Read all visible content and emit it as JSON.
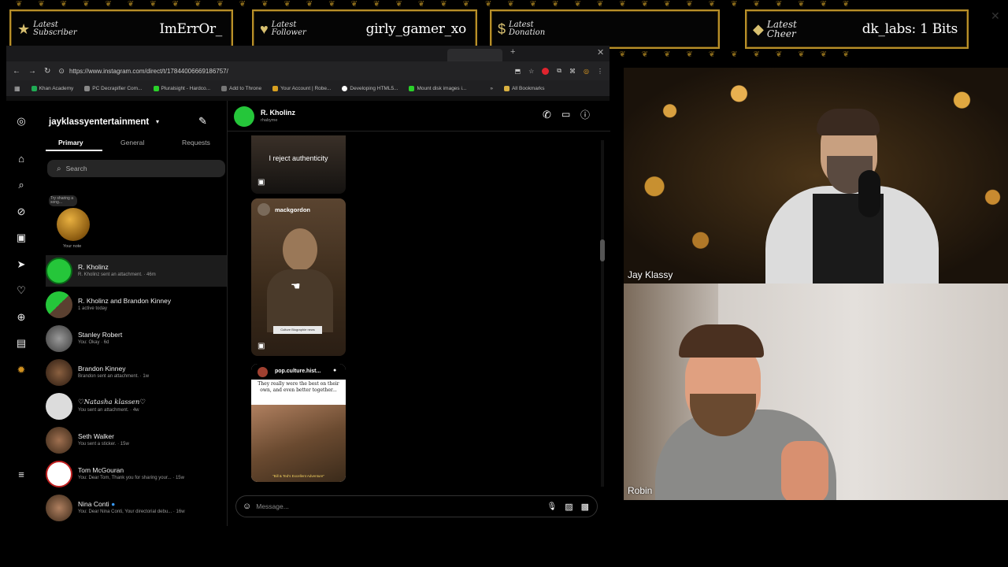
{
  "alerts": [
    {
      "label": "Latest Subscriber",
      "value": "ImErrOr_"
    },
    {
      "label": "Latest Follower",
      "value": "girly_gamer_xo"
    },
    {
      "label": "Latest Donation",
      "value": ""
    },
    {
      "label": "Latest Cheer",
      "value": "dk_labs: 1 Bits"
    }
  ],
  "browser": {
    "url": "https://www.instagram.com/direct/t/17844006669186757/",
    "bookmarks": [
      "Khan Academy",
      "PC Decrapifier Com...",
      "Pluralsight - Hardco...",
      "Add to Throne",
      "Your Account | Robe...",
      "Developing HTML5...",
      "Mount disk images i..."
    ],
    "all_bookmarks": "All Bookmarks"
  },
  "instagram": {
    "account": "jayklassyentertainment",
    "tabs": {
      "primary": "Primary",
      "general": "General",
      "requests": "Requests"
    },
    "search_placeholder": "Search",
    "note_text": "Try sharing a song...",
    "your_note": "Your note",
    "conversations": [
      {
        "name": "R. Kholinz",
        "sub": "R. Kholinz sent an attachment. · 46m",
        "color": "#25c63a"
      },
      {
        "name": "R. Kholinz and Brandon Kinney",
        "sub": "1 active today",
        "color": "#25c63a"
      },
      {
        "name": "Stanley Robert",
        "sub": "You: Okay · 6d",
        "color": "#6a6a6a"
      },
      {
        "name": "Brandon Kinney",
        "sub": "Brandon sent an attachment. · 1w",
        "color": "#5a4030"
      },
      {
        "name": "♡Natasha klassen♡",
        "sub": "You sent an attachment. · 4w",
        "color": "#dcdcdc"
      },
      {
        "name": "Seth Walker",
        "sub": "You sent a sticker. · 15w",
        "color": "#6b4a32"
      },
      {
        "name": "Tom McGouran",
        "sub": "You: Dear Tom, Thank you for sharing your... · 15w",
        "color": "#ffffff"
      },
      {
        "name": "Nina Conti",
        "sub": "You: Dear Nina Conti, Your directorial debu... · 16w",
        "color": "#7a5a40"
      }
    ],
    "chat": {
      "name": "R. Kholinz",
      "handle": "rhabyme",
      "post1_caption": "I reject authenticity",
      "post2_user": "mackgordon",
      "post2_caption": "Culture Biographie news",
      "post3_user": "pop.culture.hist...",
      "post3_text": "They really were the best on their own, and even better together...",
      "post3_caption": "\"Bill & Ted's Excellent Adventure\"",
      "message_placeholder": "Message..."
    }
  },
  "cams": {
    "top_label": "Jay Klassy",
    "bottom_label": "Robin"
  }
}
